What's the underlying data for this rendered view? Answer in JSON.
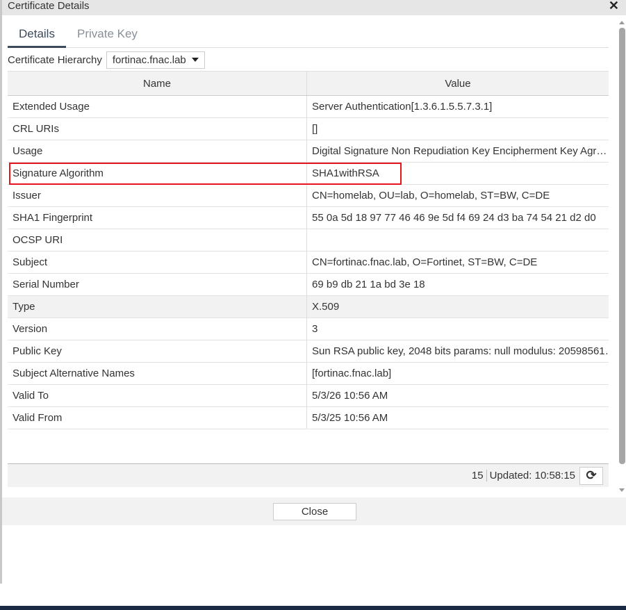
{
  "window": {
    "title": "Certificate Details",
    "close_icon": "close-icon"
  },
  "tabs": [
    {
      "label": "Details",
      "active": true
    },
    {
      "label": "Private Key",
      "active": false
    }
  ],
  "hierarchy": {
    "label": "Certificate Hierarchy",
    "selected": "fortinac.fnac.lab"
  },
  "table": {
    "headers": [
      "Name",
      "Value"
    ],
    "rows": [
      {
        "name": "Extended Usage",
        "value": "Server Authentication[1.3.6.1.5.5.7.3.1]"
      },
      {
        "name": "CRL URIs",
        "value": "[]"
      },
      {
        "name": "Usage",
        "value": "Digital Signature Non Repudiation Key Encipherment Key Agr…"
      },
      {
        "name": "Signature Algorithm",
        "value": "SHA1withRSA",
        "highlighted_box": true
      },
      {
        "name": "Issuer",
        "value": "CN=homelab, OU=lab, O=homelab, ST=BW, C=DE"
      },
      {
        "name": "SHA1 Fingerprint",
        "value": "55 0a 5d 18 97 77 46 46 9e 5d f4 69 24 d3 ba 74 54 21 d2 d0"
      },
      {
        "name": "OCSP URI",
        "value": ""
      },
      {
        "name": "Subject",
        "value": "CN=fortinac.fnac.lab, O=Fortinet, ST=BW, C=DE"
      },
      {
        "name": "Serial Number",
        "value": "69 b9 db 21 1a bd 3e 18"
      },
      {
        "name": "Type",
        "value": "X.509",
        "hover": true
      },
      {
        "name": "Version",
        "value": "3"
      },
      {
        "name": "Public Key",
        "value": "Sun RSA public key, 2048 bits params: null modulus: 20598561…"
      },
      {
        "name": "Subject Alternative Names",
        "value": "[fortinac.fnac.lab]"
      },
      {
        "name": "Valid To",
        "value": "5/3/26 10:56 AM"
      },
      {
        "name": "Valid From",
        "value": "5/3/25 10:56 AM"
      }
    ]
  },
  "footer": {
    "count": "15",
    "updated": "Updated: 10:58:15",
    "refresh_icon": "refresh-icon"
  },
  "buttons": {
    "close": "Close"
  },
  "colors": {
    "highlight_box": "#e8141c",
    "tab_active": "#3d4a5c"
  }
}
